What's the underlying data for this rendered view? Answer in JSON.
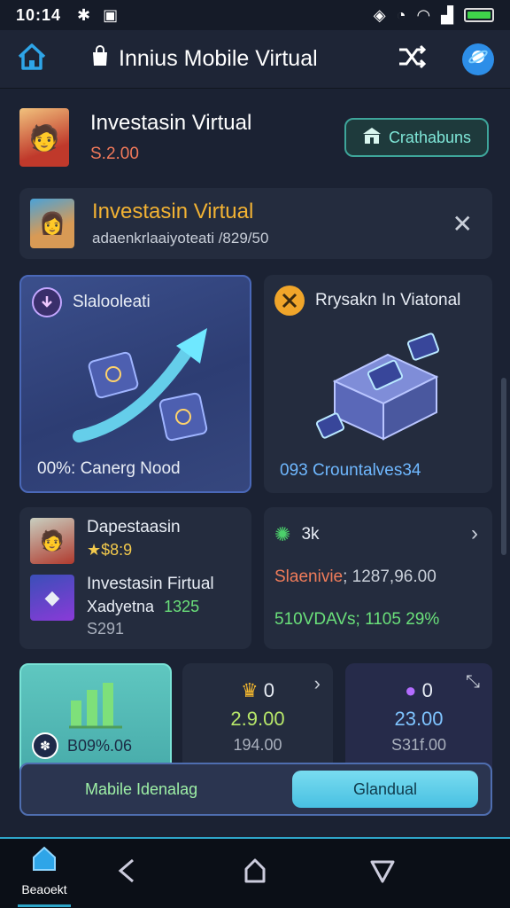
{
  "status_bar": {
    "time": "10:14"
  },
  "app_bar": {
    "title": "Innius  Mobile Virtual"
  },
  "profile": {
    "name": "Investasin Virtual",
    "value": "S.2.00",
    "action_label": "Crathabuns"
  },
  "banner": {
    "title": "Investasin Virtual",
    "subtitle": "adaenkrlaaiyoteati /829/50"
  },
  "card_a": {
    "title": "Slalooleati",
    "footer": "00%: Canerg Nood"
  },
  "card_b": {
    "title": "Rrysakn In Viatonal",
    "footer": "093 Crountalves34"
  },
  "card_c": {
    "item1_title": "Dapestaasin",
    "item1_value": "★$8:9",
    "item2_title": "Investasin Firtual",
    "item2_sub": "Xadyetna",
    "item2_value": "1325",
    "item2_extra": "S291"
  },
  "card_d": {
    "title": "3k",
    "line1_label": "Slaenivie",
    "line1_value": "; 1287,96.00",
    "line2": "510VDAVs; 1105 29%"
  },
  "tiles": {
    "tile1_label": "B09%.06",
    "tile2_count": "0",
    "tile2_value": "2.9.00",
    "tile2_sub": "194.00",
    "tile3_count": "0",
    "tile3_value": "23.00",
    "tile3_sub": "S31f.00"
  },
  "bottom_actions": {
    "left_label": "Mabile Idenalag",
    "right_label": "Glandual"
  },
  "nav": {
    "home_label": "Beaoekt"
  }
}
